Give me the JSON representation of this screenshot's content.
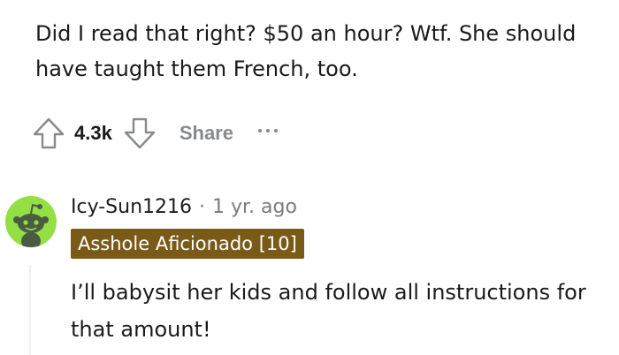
{
  "comment": {
    "text": "Did I read that right? $50 an hour? Wtf. She should have taught them French, too.",
    "vote_count": "4.3k",
    "share_label": "Share",
    "upvote_icon": "upvote-arrow-icon",
    "downvote_icon": "downvote-arrow-icon",
    "more_icon": "more-options-icon"
  },
  "reply": {
    "username": "Icy-Sun1216",
    "separator": "·",
    "timestamp": "1 yr. ago",
    "flair": "Asshole Aficionado [10]",
    "text": "I’ll babysit her kids and follow all instructions for that amount!",
    "avatar_icon": "snoo-avatar-icon"
  },
  "colors": {
    "flair_bg": "#7a5a17",
    "avatar_bg": "#94e044",
    "muted_text": "#878a8c"
  }
}
